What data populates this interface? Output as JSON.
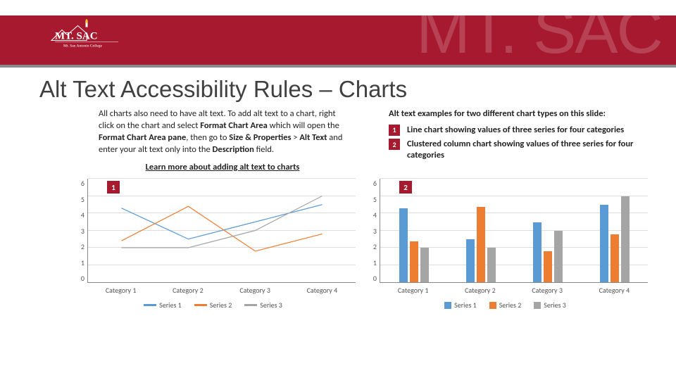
{
  "header": {
    "brand": "MT. SAC",
    "brand_sub": "Mt. San Antonio College",
    "watermark": "MT. SAC"
  },
  "title": "Alt Text Accessibility Rules – Charts",
  "left_col": {
    "text_parts": [
      "All charts also need to have alt text. To add alt text to a chart, right click on the chart and select ",
      "Format Chart Area",
      " which will open the ",
      "Format Chart Area pane",
      ", then go to ",
      "Size & Properties",
      " > ",
      "Alt Text",
      " and enter your alt text only into the ",
      "Description",
      " field."
    ],
    "link": "Learn more about adding alt text to charts"
  },
  "right_col": {
    "intro": "Alt text examples for two different chart types on this slide:",
    "items": [
      {
        "num": "1",
        "text": "Line chart showing values of three series for four categories"
      },
      {
        "num": "2",
        "text": "Clustered column chart showing values of three series for four categories"
      }
    ]
  },
  "chart_data": [
    {
      "type": "line",
      "badge": "1",
      "categories": [
        "Category 1",
        "Category 2",
        "Category 3",
        "Category 4"
      ],
      "series": [
        {
          "name": "Series 1",
          "color": "#5B9BD5",
          "values": [
            4.3,
            2.5,
            3.5,
            4.5
          ]
        },
        {
          "name": "Series 2",
          "color": "#ED7D31",
          "values": [
            2.4,
            4.4,
            1.8,
            2.8
          ]
        },
        {
          "name": "Series 3",
          "color": "#A5A5A5",
          "values": [
            2.0,
            2.0,
            3.0,
            5.0
          ]
        }
      ],
      "ylim": [
        0,
        6
      ],
      "yticks": [
        0,
        1,
        2,
        3,
        4,
        5,
        6
      ]
    },
    {
      "type": "bar",
      "badge": "2",
      "categories": [
        "Category 1",
        "Category 2",
        "Category 3",
        "Category 4"
      ],
      "series": [
        {
          "name": "Series 1",
          "color": "#5B9BD5",
          "values": [
            4.3,
            2.5,
            3.5,
            4.5
          ]
        },
        {
          "name": "Series 2",
          "color": "#ED7D31",
          "values": [
            2.4,
            4.4,
            1.8,
            2.8
          ]
        },
        {
          "name": "Series 3",
          "color": "#A5A5A5",
          "values": [
            2.0,
            2.0,
            3.0,
            5.0
          ]
        }
      ],
      "ylim": [
        0,
        6
      ],
      "yticks": [
        0,
        1,
        2,
        3,
        4,
        5,
        6
      ]
    }
  ]
}
